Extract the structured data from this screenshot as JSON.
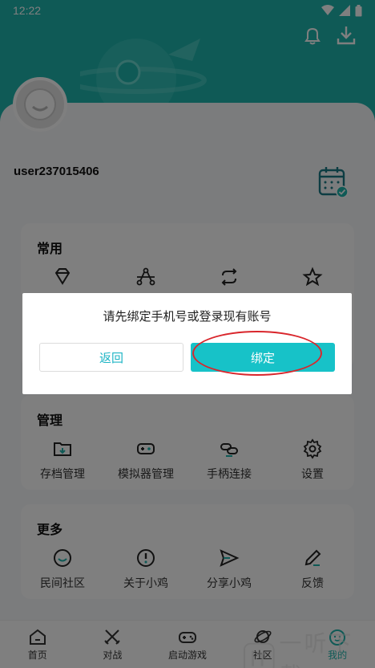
{
  "status_bar": {
    "time": "12:22"
  },
  "profile": {
    "username": "user237015406"
  },
  "sections": {
    "common": {
      "title": "常用"
    },
    "manage": {
      "title": "管理",
      "items": [
        {
          "label": "存档管理",
          "icon": "folder-icon"
        },
        {
          "label": "模拟器管理",
          "icon": "gamepad-icon"
        },
        {
          "label": "手柄连接",
          "icon": "link-icon"
        },
        {
          "label": "设置",
          "icon": "gear-icon"
        }
      ]
    },
    "more": {
      "title": "更多",
      "items": [
        {
          "label": "民间社区",
          "icon": "smile-icon"
        },
        {
          "label": "关于小鸡",
          "icon": "info-icon"
        },
        {
          "label": "分享小鸡",
          "icon": "send-icon"
        },
        {
          "label": "反馈",
          "icon": "pen-icon"
        }
      ]
    }
  },
  "tabbar": {
    "items": [
      {
        "label": "首页",
        "icon": "home-icon"
      },
      {
        "label": "对战",
        "icon": "swords-icon"
      },
      {
        "label": "启动游戏",
        "icon": "controller-icon"
      },
      {
        "label": "社区",
        "icon": "planet-icon"
      },
      {
        "label": "我的",
        "icon": "chick-face-icon"
      }
    ],
    "active": "我的"
  },
  "dialog": {
    "message": "请先绑定手机号或登录现有账号",
    "back_label": "返回",
    "bind_label": "绑定"
  },
  "watermark": {
    "text": "一听下载"
  },
  "colors": {
    "accent": "#1fb5ad",
    "button": "#17c2c8",
    "annotation": "#d9262c"
  }
}
